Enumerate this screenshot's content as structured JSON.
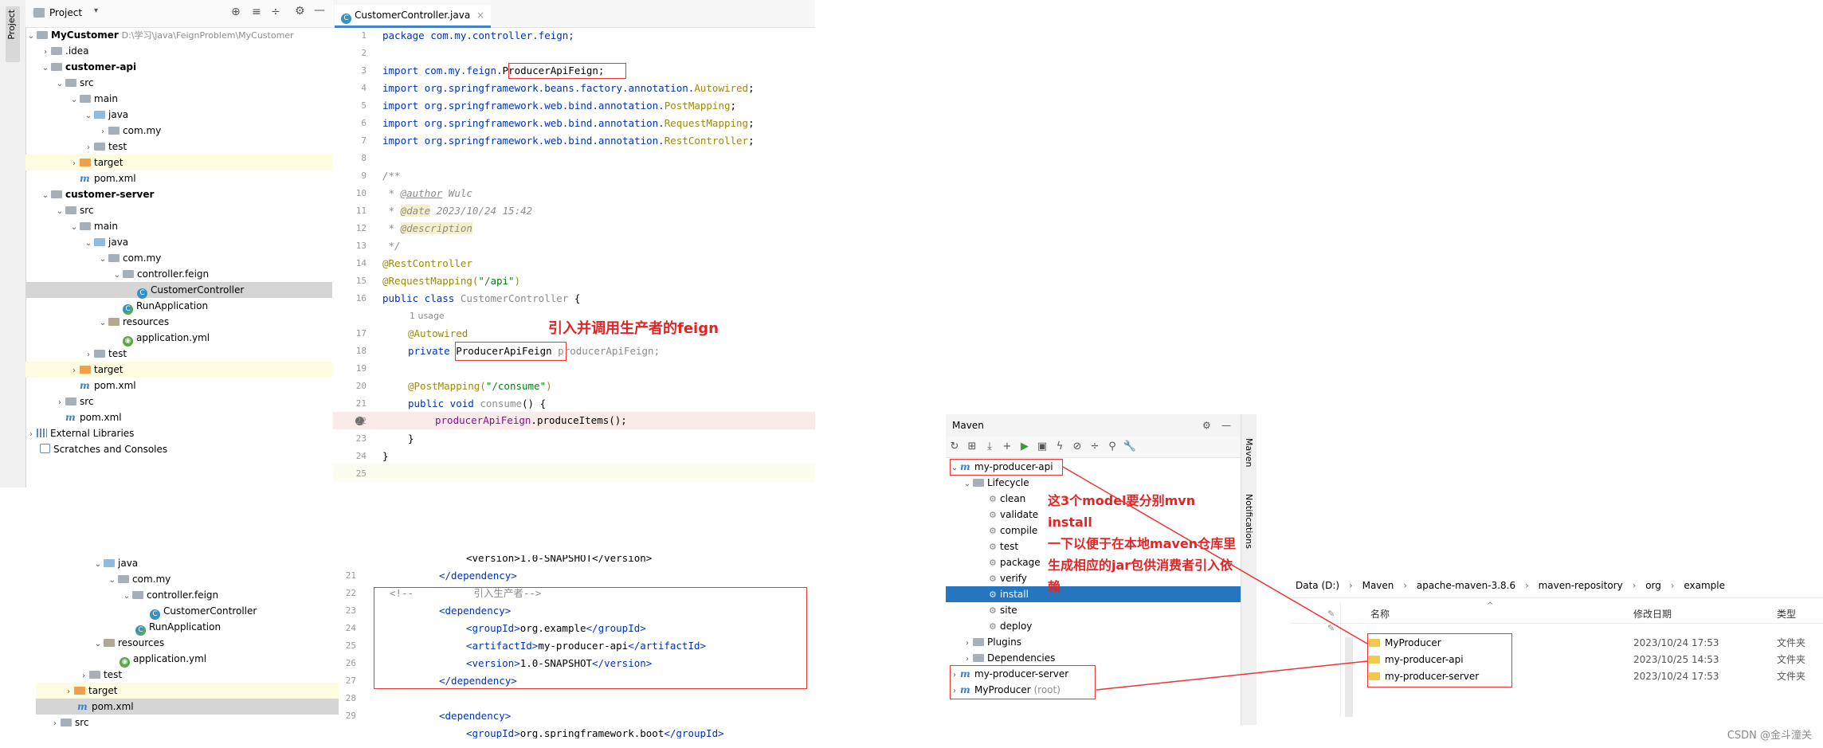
{
  "project_panel": {
    "title": "Project",
    "side_tab": "Project",
    "tree": [
      {
        "label": "MyCustomer",
        "path": "D:\\学习\\java\\FeignProblem\\MyCustomer"
      },
      {
        "label": ".idea"
      },
      {
        "label": "customer-api"
      },
      {
        "label": "src"
      },
      {
        "label": "main"
      },
      {
        "label": "java"
      },
      {
        "label": "com.my"
      },
      {
        "label": "test"
      },
      {
        "label": "target"
      },
      {
        "label": "pom.xml"
      },
      {
        "label": "customer-server"
      },
      {
        "label": "src"
      },
      {
        "label": "main"
      },
      {
        "label": "java"
      },
      {
        "label": "com.my"
      },
      {
        "label": "controller.feign"
      },
      {
        "label": "CustomerController"
      },
      {
        "label": "RunApplication"
      },
      {
        "label": "resources"
      },
      {
        "label": "application.yml"
      },
      {
        "label": "test"
      },
      {
        "label": "target"
      },
      {
        "label": "pom.xml"
      },
      {
        "label": "src"
      },
      {
        "label": "pom.xml"
      },
      {
        "label": "External Libraries"
      },
      {
        "label": "Scratches and Consoles"
      }
    ]
  },
  "editor": {
    "tab_label": "CustomerController.java",
    "line_numbers": [
      "1",
      "2",
      "3",
      "4",
      "5",
      "6",
      "7",
      "8",
      "9",
      "10",
      "11",
      "12",
      "13",
      "14",
      "15",
      "16",
      "17",
      "18",
      "19",
      "20",
      "21",
      "22",
      "23",
      "24",
      "25"
    ],
    "code": {
      "l1": "package com.my.controller.feign;",
      "l3_pre": "import com.my.feign.",
      "l3_cls": "ProducerApiFeign;",
      "l4_pre": "import org.springframework.beans.factory.annotation.",
      "l4_an": "Autowired",
      "l5_pre": "import org.springframework.web.bind.annotation.",
      "l5_an": "PostMapping",
      "l6_pre": "import org.springframework.web.bind.annotation.",
      "l6_an": "RequestMapping",
      "l7_pre": "import org.springframework.web.bind.annotation.",
      "l7_an": "RestController",
      "l9": "/**",
      "l10_pre": " * ",
      "l10_tag": "@author",
      "l10_val": " Wulc",
      "l11_pre": " * ",
      "l11_tag": "@date",
      "l11_val": " 2023/10/24 15:42",
      "l12_pre": " * ",
      "l12_tag": "@description",
      "l13": " */",
      "l14": "@RestController",
      "l15_an": "@RequestMapping(",
      "l15_str": "\"/api\"",
      "l15_end": ")",
      "l16_kw": "public class ",
      "l16_name": "CustomerController",
      "l16_end": " {",
      "usage": "1 usage",
      "l17": "@Autowired",
      "l18_kw": "private ",
      "l18_type": "ProducerApiFeign",
      "l18_field": " producerApiFeign;",
      "l20_an": "@PostMapping(",
      "l20_str": "\"/consume\"",
      "l20_end": ")",
      "l21_kw": "public void ",
      "l21_name": "consume",
      "l21_end": "() {",
      "l22_field": "producerApiFeign",
      "l22_call": ".produceItems();",
      "l23": "}",
      "l24": "}"
    },
    "annotation": "引入并调用生产者的feign"
  },
  "bottom_tree": [
    {
      "label": "java"
    },
    {
      "label": "com.my"
    },
    {
      "label": "controller.feign"
    },
    {
      "label": "CustomerController"
    },
    {
      "label": "RunApplication"
    },
    {
      "label": "resources"
    },
    {
      "label": "application.yml"
    },
    {
      "label": "test"
    },
    {
      "label": "target"
    },
    {
      "label": "pom.xml"
    },
    {
      "label": "src"
    }
  ],
  "pom_snippet": {
    "line_numbers": [
      "21",
      "22",
      "23",
      "24",
      "25",
      "26",
      "27",
      "28",
      "29"
    ],
    "l20": "<version>1.0-SNAPSHOT</version>",
    "l21": "</dependency>",
    "l22": "<!--          引入生产者-->",
    "l23": "<dependency>",
    "l24_open": "<groupId>",
    "l24_val": "org.example",
    "l24_close": "</groupId>",
    "l25_open": "<artifactId>",
    "l25_val": "my-producer-api",
    "l25_close": "</artifactId>",
    "l26_open": "<version>",
    "l26_val": "1.0-SNAPSHOT",
    "l26_close": "</version>",
    "l27": "</dependency>",
    "l29": "<dependency>",
    "l30_open": "<groupId>",
    "l30_val": "org.springframework.boot",
    "l30_close": "</groupId>"
  },
  "maven_panel": {
    "title": "Maven",
    "side_labels": [
      "Maven",
      "Notifications"
    ],
    "tree": [
      {
        "label": "my-producer-api"
      },
      {
        "label": "Lifecycle"
      },
      {
        "label": "clean"
      },
      {
        "label": "validate"
      },
      {
        "label": "compile"
      },
      {
        "label": "test"
      },
      {
        "label": "package"
      },
      {
        "label": "verify"
      },
      {
        "label": "install"
      },
      {
        "label": "site"
      },
      {
        "label": "deploy"
      },
      {
        "label": "Plugins"
      },
      {
        "label": "Dependencies"
      },
      {
        "label": "my-producer-server"
      },
      {
        "label": "MyProducer",
        "suffix": "(root)"
      }
    ],
    "annotation_lines": [
      "这3个model要分别mvn install",
      "一下以便于在本地maven仓库里",
      "生成相应的jar包供消费者引入依",
      "赖"
    ]
  },
  "explorer": {
    "breadcrumb": [
      "Data (D:)",
      "Maven",
      "apache-maven-3.8.6",
      "maven-repository",
      "org",
      "example"
    ],
    "columns": [
      "名称",
      "修改日期",
      "类型"
    ],
    "rows": [
      {
        "name": "MyProducer",
        "date": "2023/10/24 17:53",
        "type": "文件夹"
      },
      {
        "name": "my-producer-api",
        "date": "2023/10/25 14:53",
        "type": "文件夹"
      },
      {
        "name": "my-producer-server",
        "date": "2023/10/24 17:53",
        "type": "文件夹"
      }
    ]
  },
  "watermark": "CSDN @金斗潼关",
  "colors": {
    "accent": "#2675bf",
    "annotation_red": "#e32424",
    "keyword": "#0033b3",
    "annotation": "#9e880d"
  }
}
